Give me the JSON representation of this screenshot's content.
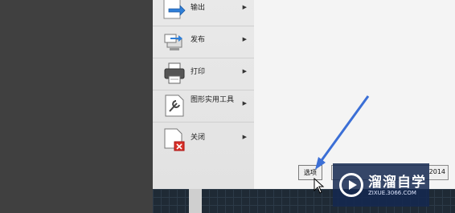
{
  "menu": {
    "items": [
      {
        "label": "输出",
        "icon": "export-icon"
      },
      {
        "label": "发布",
        "icon": "publish-icon"
      },
      {
        "label": "打印",
        "icon": "printer-icon"
      },
      {
        "label": "图形实用工具",
        "icon": "drawing-utilities-icon"
      },
      {
        "label": "关闭",
        "icon": "close-drawing-icon"
      }
    ],
    "arrow_glyph": "▶"
  },
  "buttons": {
    "options_label": "选项",
    "exit_label": "2014"
  },
  "watermark": {
    "title": "溜溜自学",
    "url": "ZIXUE.3066.COM"
  },
  "colors": {
    "annotation_arrow": "#3b6fd6",
    "canvas_background": "#1f2a35"
  }
}
